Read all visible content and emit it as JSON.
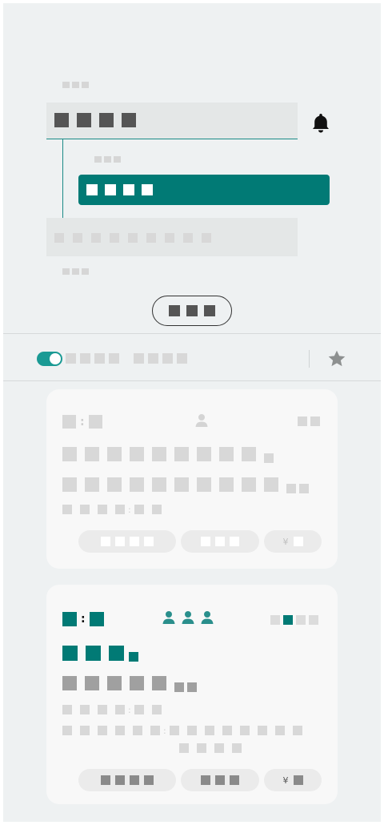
{
  "picker": {
    "selected_field": "",
    "selected_item": "",
    "more_button": ""
  },
  "icons": {
    "bell": "bell-icon",
    "star": "star-icon",
    "person": "person-icon"
  },
  "colors": {
    "accent": "#017a75",
    "toggle": "#1a9a94",
    "panel_bg": "#eef1f2",
    "card_bg": "#f8f8f8"
  },
  "filter": {
    "toggle_on": true
  },
  "cards": [
    {
      "state": "inactive",
      "capacity_filled": 1,
      "capacity_total": 2,
      "price_symbol": "¥"
    },
    {
      "state": "active",
      "capacity_filled": 2,
      "capacity_total": 4,
      "price_symbol": "¥"
    }
  ]
}
